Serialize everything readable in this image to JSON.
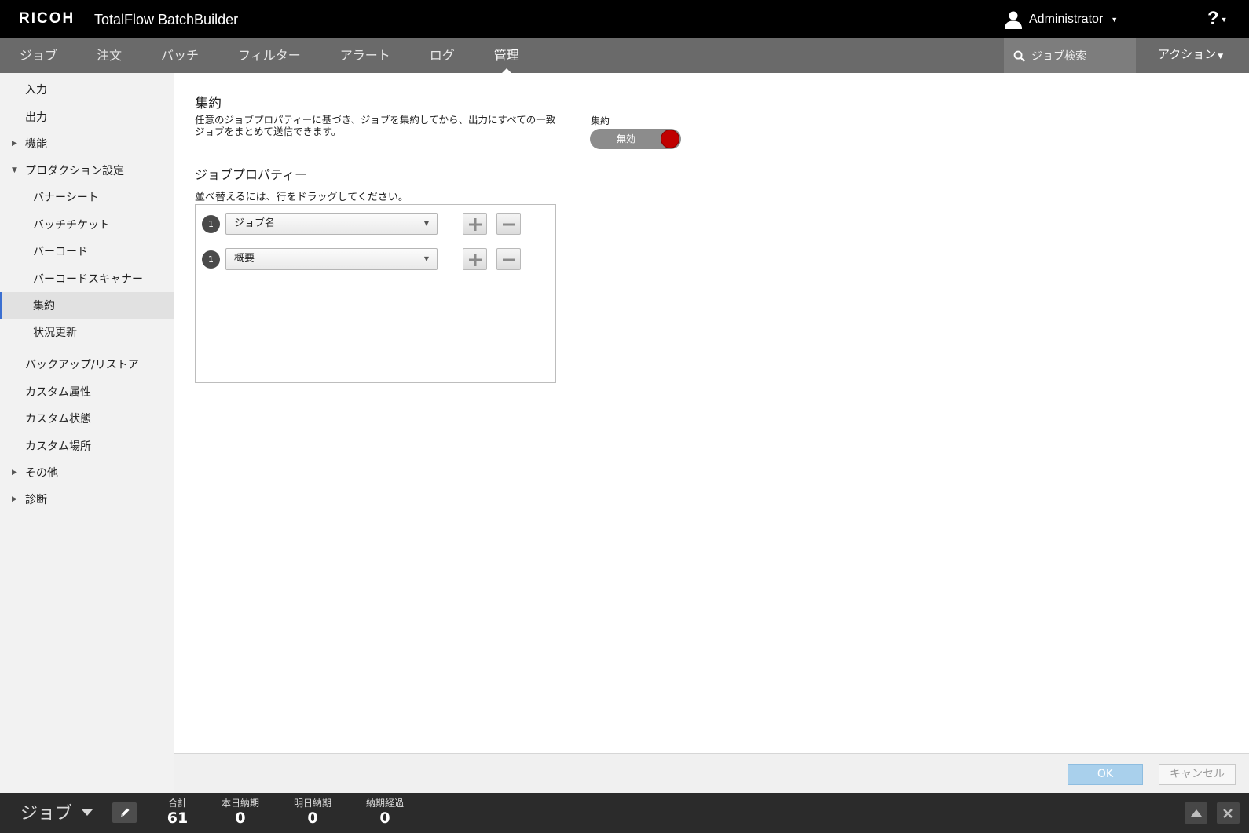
{
  "header": {
    "brand": "RICOH",
    "product": "TotalFlow BatchBuilder",
    "user": "Administrator",
    "help": "?"
  },
  "nav": {
    "tabs": [
      "ジョブ",
      "注文",
      "バッチ",
      "フィルター",
      "アラート",
      "ログ",
      "管理"
    ],
    "active_tab": "管理",
    "search_placeholder": "ジョブ検索",
    "action_label": "アクション"
  },
  "sidebar": {
    "items": [
      {
        "label": "入力"
      },
      {
        "label": "出力"
      },
      {
        "label": "機能",
        "expandable": true,
        "expanded": false
      },
      {
        "label": "プロダクション設定",
        "expandable": true,
        "expanded": true
      },
      {
        "label": "バナーシート"
      },
      {
        "label": "バッチチケット"
      },
      {
        "label": "バーコード"
      },
      {
        "label": "バーコードスキャナー"
      },
      {
        "label": "集約",
        "selected": true
      },
      {
        "label": "状況更新"
      },
      {
        "label": "バックアップ/リストア"
      },
      {
        "label": "カスタム属性"
      },
      {
        "label": "カスタム状態"
      },
      {
        "label": "カスタム場所"
      },
      {
        "label": "その他",
        "expandable": true,
        "expanded": false
      },
      {
        "label": "診断",
        "expandable": true,
        "expanded": false
      }
    ]
  },
  "main": {
    "title": "集約",
    "description": "任意のジョブプロパティーに基づき、ジョブを集約してから、出力にすべての一致ジョブをまとめて送信できます。",
    "toggle_label": "集約",
    "toggle_state": "無効",
    "toggle_color": "#c00000",
    "job_properties_title": "ジョブプロパティー",
    "drag_hint": "並べ替えるには、行をドラッグしてください。",
    "property_rows": [
      {
        "number": "1",
        "value": "ジョブ名"
      },
      {
        "number": "1",
        "value": "概要"
      }
    ]
  },
  "dialog": {
    "ok_label": "OK",
    "cancel_label": "キャンセル"
  },
  "statusbar": {
    "view_label": "ジョブ",
    "stats": [
      {
        "label": "合計",
        "value": "61"
      },
      {
        "label": "本日納期",
        "value": "0"
      },
      {
        "label": "明日納期",
        "value": "0"
      },
      {
        "label": "納期経過",
        "value": "0"
      }
    ]
  }
}
